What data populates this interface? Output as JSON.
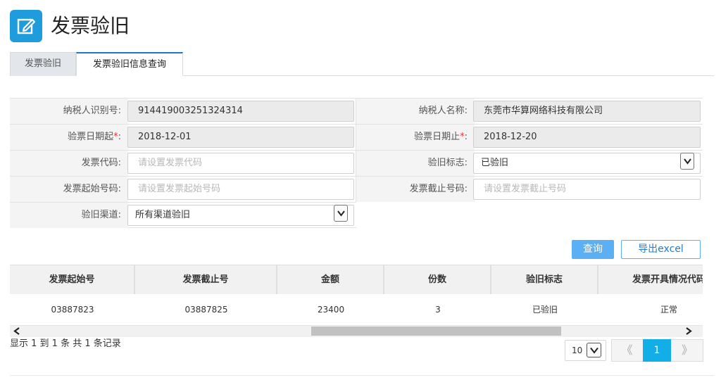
{
  "header": {
    "title": "发票验旧",
    "icon": "edit-note-icon",
    "accent": "#1e9cdc"
  },
  "tabs": [
    {
      "label": "发票验旧",
      "active": false
    },
    {
      "label": "发票验旧信息查询",
      "active": true
    }
  ],
  "form": {
    "taxpayer_id": {
      "label": "纳税人识别号:",
      "value": "914419003251324314"
    },
    "taxpayer_name": {
      "label": "纳税人名称:",
      "value": "东莞市华算网络科技有限公司"
    },
    "date_start": {
      "label": "验票日期起",
      "required_mark": "*",
      "colon": ":",
      "value": "2018-12-01"
    },
    "date_end": {
      "label": "验票日期止",
      "required_mark": "*",
      "colon": ":",
      "value": "2018-12-20"
    },
    "invoice_code": {
      "label": "发票代码:",
      "placeholder": "请设置发票代码"
    },
    "check_flag": {
      "label": "验旧标志:",
      "value": "已验旧"
    },
    "start_no": {
      "label": "发票起始号码:",
      "placeholder": "请设置发票起始号码"
    },
    "end_no": {
      "label": "发票截止号码:",
      "placeholder": "请设置发票截止号码"
    },
    "channel": {
      "label": "验旧渠道:",
      "value": "所有渠道验旧"
    }
  },
  "buttons": {
    "query": "查询",
    "export": "导出excel"
  },
  "table": {
    "columns": [
      "发票起始号",
      "发票截止号",
      "金额",
      "份数",
      "验旧标志",
      "发票开具情况代码"
    ],
    "rows": [
      [
        "03887823",
        "03887825",
        "23400",
        "3",
        "已验旧",
        "正常"
      ]
    ]
  },
  "pagination": {
    "summary": "显示 1 到 1 条 共 1 条记录",
    "page_size": "10",
    "prev": "《",
    "current": "1",
    "next": "》"
  },
  "scroll": {
    "left_arrow": "‹",
    "right_arrow": "›"
  }
}
